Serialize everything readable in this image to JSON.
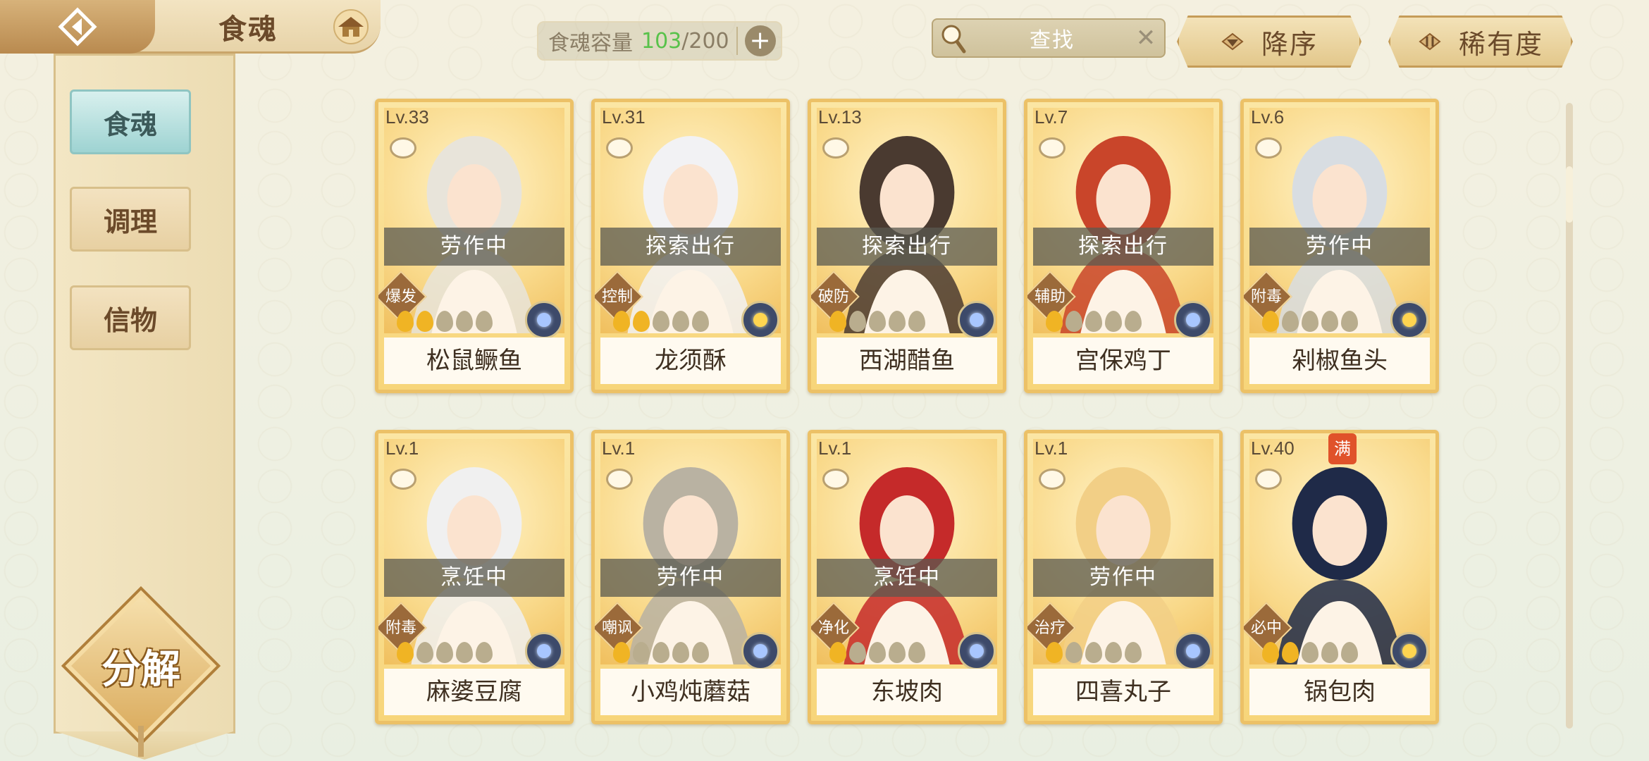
{
  "header": {
    "back_icon": "back-arrow-icon",
    "title": "食魂",
    "home_icon": "house-icon",
    "capacity": {
      "label": "食魂容量",
      "current": "103",
      "total": "/200",
      "plus": "+"
    },
    "search": {
      "placeholder": "查找",
      "clear": "✕"
    },
    "sort_order": "降序",
    "sort_key": "稀有度"
  },
  "sidebar": {
    "items": [
      {
        "label": "食魂",
        "active": true
      },
      {
        "label": "调理",
        "active": false
      },
      {
        "label": "信物",
        "active": false
      }
    ],
    "decompose_label": "分解"
  },
  "cards": [
    {
      "level": "Lv.33",
      "status": "劳作中",
      "role": "爆发",
      "stars": 2,
      "element": "blue",
      "name": "松鼠鳜鱼",
      "hair": "#e8e4da"
    },
    {
      "level": "Lv.31",
      "status": "探索出行",
      "role": "控制",
      "stars": 2,
      "element": "gold",
      "name": "龙须酥",
      "hair": "#f2f2f4"
    },
    {
      "level": "Lv.13",
      "status": "探索出行",
      "role": "破防",
      "stars": 1,
      "element": "blue",
      "name": "西湖醋鱼",
      "hair": "#4a3a30"
    },
    {
      "level": "Lv.7",
      "status": "探索出行",
      "role": "辅助",
      "stars": 1,
      "element": "blue",
      "name": "宫保鸡丁",
      "hair": "#c9452a"
    },
    {
      "level": "Lv.6",
      "status": "劳作中",
      "role": "附毒",
      "stars": 1,
      "element": "gold",
      "name": "剁椒鱼头",
      "hair": "#d8dde2"
    },
    {
      "level": "Lv.1",
      "status": "烹饪中",
      "role": "附毒",
      "stars": 1,
      "element": "blue",
      "name": "麻婆豆腐",
      "hair": "#f0f0f0"
    },
    {
      "level": "Lv.1",
      "status": "劳作中",
      "role": "嘲讽",
      "stars": 1,
      "element": "blue",
      "name": "小鸡炖蘑菇",
      "hair": "#b9b2a2"
    },
    {
      "level": "Lv.1",
      "status": "烹饪中",
      "role": "净化",
      "stars": 1,
      "element": "blue",
      "name": "东坡肉",
      "hair": "#c52a2a"
    },
    {
      "level": "Lv.1",
      "status": "劳作中",
      "role": "治疗",
      "stars": 1,
      "element": "blue",
      "name": "四喜丸子",
      "hair": "#f2cf86"
    },
    {
      "level": "Lv.40",
      "status": "",
      "role": "必中",
      "stars": 2,
      "element": "gold",
      "name": "锅包肉",
      "hair": "#1f2a48",
      "full_badge": "满"
    }
  ],
  "colors": {
    "accent_teal": "#9ed3d2",
    "gold": "#ecc167",
    "capacity_current": "#58c24a"
  }
}
